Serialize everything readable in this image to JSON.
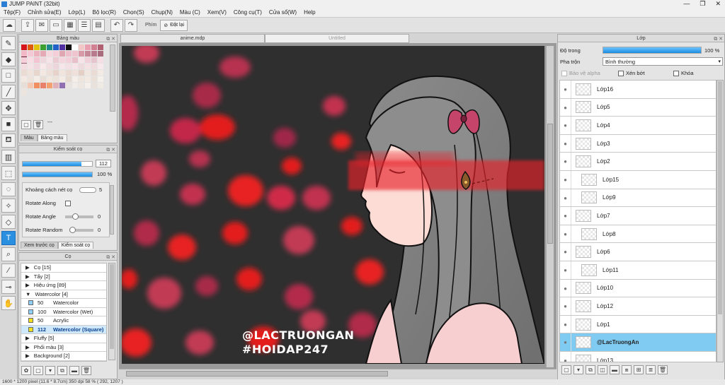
{
  "app": {
    "title": "JUMP PAINT (32bit)"
  },
  "window_controls": [
    "—",
    "❐",
    "✕"
  ],
  "menu": [
    "Tệp(F)",
    "Chỉnh sửa(E)",
    "Lớp(L)",
    "Bộ lọc(R)",
    "Chọn(S)",
    "Chụp(N)",
    "Màu (C)",
    "Xem(V)",
    "Công cụ(T)",
    "Cửa sổ(W)",
    "Help"
  ],
  "toolbar": {
    "phim_label": "Phím",
    "datlai_label": "Đặt lại"
  },
  "color_panel": {
    "title": "Bảng màu",
    "tabs": [
      "Màu",
      "Bảng màu"
    ],
    "dots": "---",
    "swatch_rows": [
      [
        "#d4161b",
        "#e05a0c",
        "#e0c30f",
        "#3ca030",
        "#1e8a8c",
        "#2060c8",
        "#5030a0",
        "#101010",
        "#ffffff",
        "#f4c7c7",
        "#e8a0b0",
        "#d08090",
        "#b06070",
        "#602030"
      ],
      [
        "#f2b8c6",
        "#f5c9d3",
        "#ecb2bd",
        "#e6a9b6",
        "#f7d7de",
        "#f4cdd6",
        "#e0a7b3",
        "#eebfca",
        "#f0c4cf",
        "#d89aa8",
        "#c58896",
        "#b77b8b",
        "#a86c7d",
        "#94617a"
      ],
      [
        "#f6d0d8",
        "#f9dde3",
        "#f2c6d0",
        "#f0d7dd",
        "#f7e4e8",
        "#eccad2",
        "#f5d5dc",
        "#f3cfd7",
        "#e9c0ca",
        "#f8e3e8",
        "#f1d1d9",
        "#e8c5ce",
        "#f6dfe4",
        "#f0d6dd"
      ],
      [
        "#f3dde1",
        "#f5e2e5",
        "#efd7db",
        "#f8e8ea",
        "#f1dde0",
        "#edd6da",
        "#f7e6e9",
        "#f2e0e3",
        "#f6e4e7",
        "#eed9dd",
        "#f4e1e4",
        "#f0dbde",
        "#f8eaec",
        "#f3dfe2"
      ],
      [
        "#eadbd3",
        "#f0e3dc",
        "#e8d6cd",
        "#f3e8e2",
        "#eddfd7",
        "#e6d2c8",
        "#f1e4dd",
        "#ebdad1",
        "#efe1da",
        "#e4cfc4",
        "#f2e6e0",
        "#eadcd4",
        "#f4eae4",
        "#eee1da"
      ],
      [
        "#f1e9e2",
        "#ede3db",
        "#f4ede7",
        "#e9ded5",
        "#f0e7df",
        "#ece2d9",
        "#f3ebe4",
        "#e7dbd1",
        "#f5eee8",
        "#eee5dd",
        "#f2e9e2",
        "#ebe0d7",
        "#f6f0ea",
        "#efe6de"
      ],
      [
        "#e8ded8",
        "#f4c8b0",
        "#f09060",
        "#e8806a",
        "#f4a070",
        "#e0b0b8",
        "#9070b0",
        "#eae4e0",
        "#f2ece8",
        "#ede6e1",
        "#f4efeb",
        "#e9e2dc",
        "#f0eae5",
        "#ece5df"
      ]
    ]
  },
  "brush_control": {
    "title": "Kiểm soát cọ",
    "size": "112",
    "size_fill_fraction": 0.85,
    "opacity": "100 %",
    "opacity_fill_fraction": 1.0,
    "rows": [
      {
        "label": "Khoảng cách nét cọ",
        "value": "5"
      },
      {
        "label": "Rotate Along",
        "value": ""
      },
      {
        "label": "Rotate Angle",
        "value": "0"
      },
      {
        "label": "Rotate Random",
        "value": "0"
      }
    ],
    "tabs": [
      "Xem trước cọ",
      "Kiểm soát cọ"
    ]
  },
  "brush_panel": {
    "title": "Cọ",
    "groups": [
      {
        "label": "Cọ [15]"
      },
      {
        "label": "Tẩy [2]"
      },
      {
        "label": "Hiệu ứng [89]"
      },
      {
        "label": "Watercolor [4]",
        "open": true
      }
    ],
    "items": [
      {
        "size": "50",
        "name": "Watercolor",
        "color": "#8fd0ff"
      },
      {
        "size": "100",
        "name": "Watercolor (Wet)",
        "color": "#8fd0ff"
      },
      {
        "size": "50",
        "name": "Acrylic",
        "color": "#f0e020"
      },
      {
        "size": "112",
        "name": "Watercolor (Square)",
        "color": "#f0e020",
        "selected": true
      }
    ],
    "groups_after": [
      {
        "label": "Fluffy [5]"
      },
      {
        "label": "Phối màu [3]"
      },
      {
        "label": "Background [2]"
      }
    ]
  },
  "doc_tabs": [
    "anime.mdp",
    "Untitled"
  ],
  "canvas": {
    "watermark_line1": "@LACTRUONGAN",
    "watermark_line2": "#HOIDAP247"
  },
  "layer_panel": {
    "title": "Lớp",
    "opacity_label": "Độ trong",
    "opacity_value": "100 %",
    "opacity_fill_fraction": 1.0,
    "blend_label": "Pha trộn",
    "blend_value": "Bình thường",
    "options": [
      "Bảo vệ alpha",
      "Xén bớt",
      "Khóa"
    ],
    "layers": [
      {
        "name": "Lớp16"
      },
      {
        "name": "Lớp5"
      },
      {
        "name": "Lớp4"
      },
      {
        "name": "Lớp3"
      },
      {
        "name": "Lớp2"
      },
      {
        "name": "Lớp15",
        "indent": true
      },
      {
        "name": "Lớp9",
        "indent": true
      },
      {
        "name": "Lớp7"
      },
      {
        "name": "Lớp8",
        "indent": true
      },
      {
        "name": "Lớp6"
      },
      {
        "name": "Lớp11",
        "indent": true
      },
      {
        "name": "Lớp10"
      },
      {
        "name": "Lớp12"
      },
      {
        "name": "Lớp1"
      },
      {
        "name": "@LacTruongAn",
        "selected": true
      },
      {
        "name": "Lớp13"
      }
    ]
  },
  "statusbar": {
    "text": "1600 * 1200 pixel   (11.6 * 8.7cm)   350 dpi   58 %   ( 292, 1207 )"
  }
}
